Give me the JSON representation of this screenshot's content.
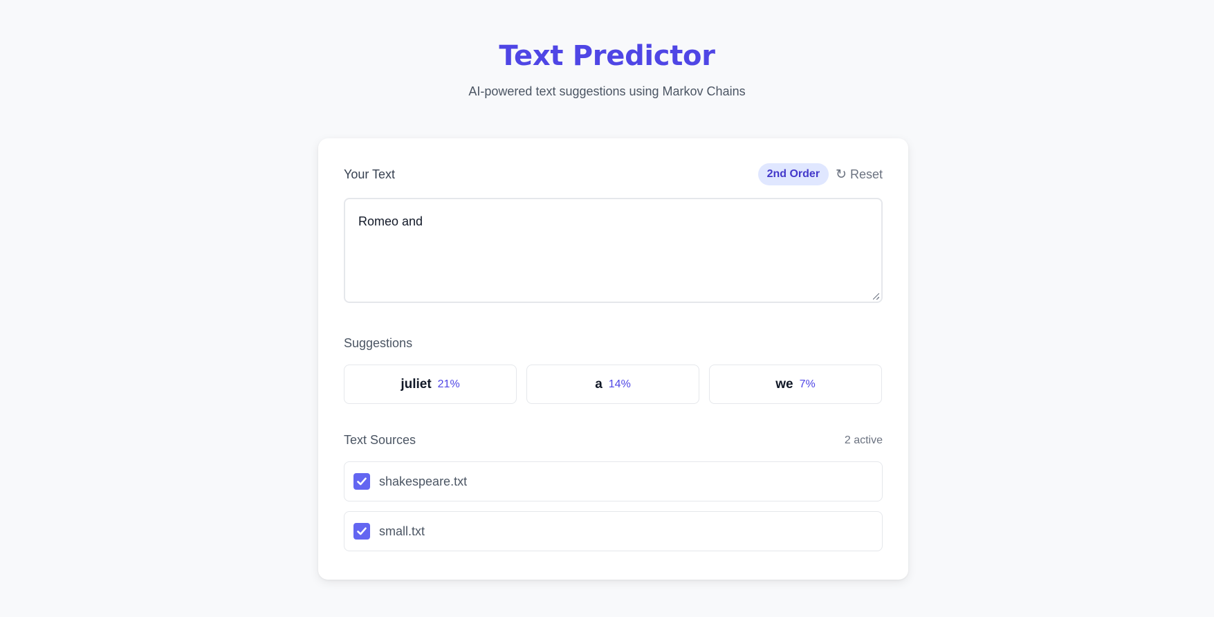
{
  "header": {
    "title": "Text Predictor",
    "subtitle": "AI-powered text suggestions using Markov Chains"
  },
  "editor": {
    "label": "Your Text",
    "order_badge": "2nd Order",
    "reset_icon": "refresh-icon",
    "reset_label": "Reset",
    "text_value": "Romeo and"
  },
  "suggestions": {
    "label": "Suggestions",
    "items": [
      {
        "word": "juliet",
        "percent": "21%"
      },
      {
        "word": "a",
        "percent": "14%"
      },
      {
        "word": "we",
        "percent": "7%"
      }
    ]
  },
  "sources": {
    "label": "Text Sources",
    "active_count": "2 active",
    "items": [
      {
        "name": "shakespeare.txt",
        "checked": true
      },
      {
        "name": "small.txt",
        "checked": true
      }
    ]
  },
  "colors": {
    "accent": "#4f46e5",
    "checkbox": "#6366f1",
    "badge_bg": "#e0e7ff",
    "background": "#f8f9fb"
  }
}
